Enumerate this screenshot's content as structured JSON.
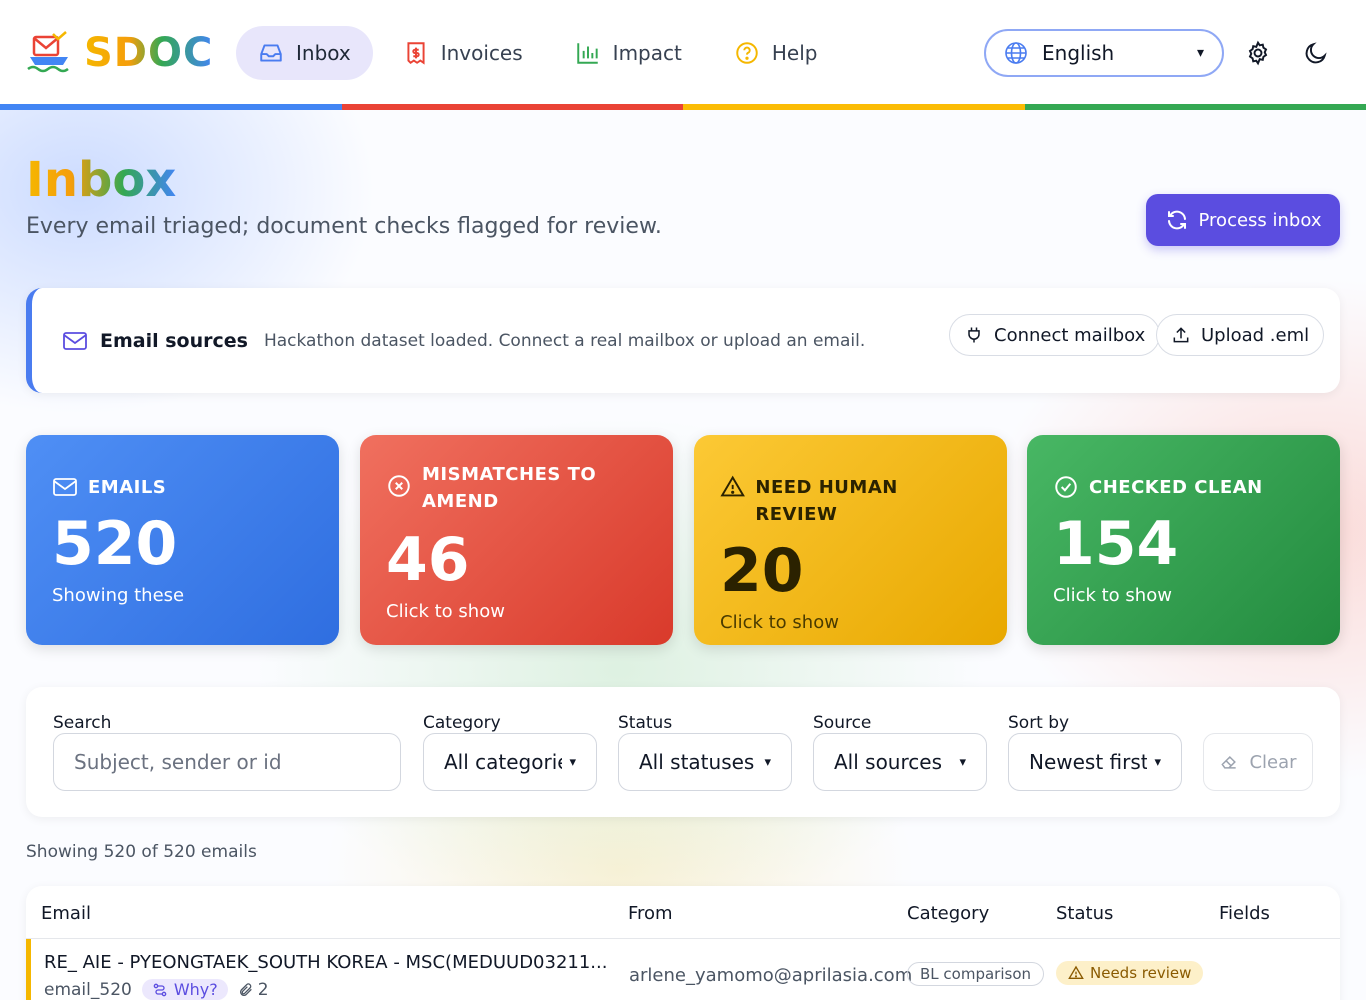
{
  "app": {
    "name": "SDOC"
  },
  "nav": [
    {
      "label": "Inbox",
      "icon": "inbox-icon",
      "active": true
    },
    {
      "label": "Invoices",
      "icon": "invoice-icon",
      "active": false
    },
    {
      "label": "Impact",
      "icon": "bar-chart-icon",
      "active": false
    },
    {
      "label": "Help",
      "icon": "help-icon",
      "active": false
    }
  ],
  "language": {
    "selected": "English"
  },
  "colors": {
    "blue": "#4285f4",
    "red": "#ea4335",
    "yellow": "#fbbc05",
    "green": "#34a853",
    "primary": "#5b4de0"
  },
  "page": {
    "title": "Inbox",
    "subtitle": "Every email triaged; document checks flagged for review.",
    "process_label": "Process inbox"
  },
  "sources": {
    "title": "Email sources",
    "description": "Hackathon dataset loaded. Connect a real mailbox or upload an email.",
    "connect_label": "Connect mailbox",
    "upload_label": "Upload .eml"
  },
  "stats": [
    {
      "label": "EMAILS",
      "value": "520",
      "sub": "Showing these",
      "icon": "mail-icon"
    },
    {
      "label": "MISMATCHES TO AMEND",
      "value": "46",
      "sub": "Click to show",
      "icon": "x-circle-icon"
    },
    {
      "label": "NEED HUMAN REVIEW",
      "value": "20",
      "sub": "Click to show",
      "icon": "warning-icon"
    },
    {
      "label": "CHECKED CLEAN",
      "value": "154",
      "sub": "Click to show",
      "icon": "check-circle-icon"
    }
  ],
  "filters": {
    "search_label": "Search",
    "search_placeholder": "Subject, sender or id",
    "category_label": "Category",
    "category_value": "All categorie",
    "status_label": "Status",
    "status_value": "All statuses",
    "source_label": "Source",
    "source_value": "All sources",
    "sort_label": "Sort by",
    "sort_value": "Newest first",
    "clear_label": "Clear"
  },
  "showing": "Showing 520 of 520 emails",
  "table": {
    "headers": {
      "email": "Email",
      "from": "From",
      "category": "Category",
      "status": "Status",
      "fields": "Fields"
    },
    "rows": [
      {
        "subject": "RE_ AIE - PYEONGTAEK_SOUTH KOREA - MSC(MEDUUD03211...",
        "id": "email_520",
        "why": "Why?",
        "attachments": "2",
        "from": "arlene_yamomo@aprilasia.com",
        "category": "BL comparison",
        "status": "Needs review"
      }
    ]
  }
}
